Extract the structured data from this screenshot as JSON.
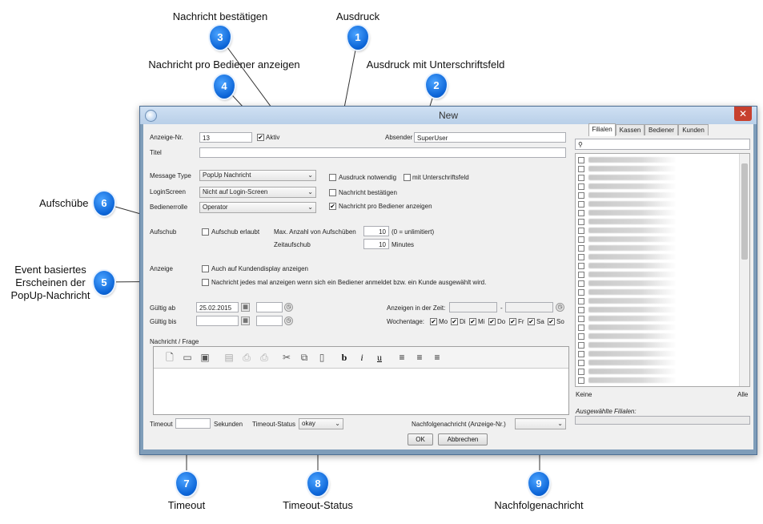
{
  "callouts": [
    {
      "n": "1",
      "label": "Ausdruck"
    },
    {
      "n": "2",
      "label": "Ausdruck mit Unterschriftsfeld"
    },
    {
      "n": "3",
      "label": "Nachricht bestätigen"
    },
    {
      "n": "4",
      "label": "Nachricht pro Bediener anzeigen"
    },
    {
      "n": "5",
      "label": "Event basiertes\nErscheinen der\nPopUp-Nachricht"
    },
    {
      "n": "6",
      "label": "Aufschübe"
    },
    {
      "n": "7",
      "label": "Timeout"
    },
    {
      "n": "8",
      "label": "Timeout-Status"
    },
    {
      "n": "9",
      "label": "Nachfolgenachricht"
    }
  ],
  "window": {
    "title": "New",
    "close_glyph": "✕"
  },
  "form": {
    "anzeige_nr_label": "Anzeige-Nr.",
    "anzeige_nr_value": "13",
    "aktiv_label": "Aktiv",
    "aktiv_checked": "✔",
    "absender_label": "Absender",
    "absender_value": "SuperUser",
    "titel_label": "Titel",
    "titel_value": "",
    "message_type_label": "Message Type",
    "message_type_value": "PopUp Nachricht",
    "loginscreen_label": "LoginScreen",
    "loginscreen_value": "Nicht auf Login-Screen",
    "bedienerrolle_label": "Bedienerrolle",
    "bedienerrolle_value": "Operator",
    "ausdruck_notwendig_label": "Ausdruck notwendig",
    "mit_unterschriftsfeld_label": "mit Unterschriftsfeld",
    "nachricht_bestaetigen_label": "Nachricht bestätigen",
    "nachricht_pro_bediener_label": "Nachricht pro Bediener anzeigen",
    "nachricht_pro_bediener_checked": "✔",
    "aufschub_label": "Aufschub",
    "aufschub_erlaubt_label": "Aufschub erlaubt",
    "max_aufschuebe_label": "Max. Anzahl von Aufschüben",
    "max_aufschuebe_value": "10",
    "unlimitiert_note": "(0 = unlimitiert)",
    "zeitaufschub_label": "Zeitaufschub",
    "zeitaufschub_value": "10",
    "minutes_label": "Minutes",
    "anzeige_label": "Anzeige",
    "kundendisplay_label": "Auch auf Kundendisplay anzeigen",
    "jedes_mal_label": "Nachricht jedes mal anzeigen wenn sich ein Bediener anmeldet bzw. ein Kunde ausgewählt wird.",
    "gueltig_ab_label": "Gültig ab",
    "gueltig_ab_value": "25.02.2015",
    "gueltig_bis_label": "Gültig bis",
    "gueltig_bis_value": "",
    "anzeigen_zeit_label": "Anzeigen in der Zeit:",
    "zeit_separator": "-",
    "wochentage_label": "Wochentage:",
    "days": [
      "Mo",
      "Di",
      "Mi",
      "Do",
      "Fr",
      "Sa",
      "So"
    ],
    "nachricht_frage_label": "Nachricht / Frage",
    "timeout_label": "Timeout",
    "timeout_value": "",
    "sekunden_label": "Sekunden",
    "timeout_status_label": "Timeout-Status",
    "timeout_status_value": "okay",
    "nachfolge_label": "Nachfolgenachricht (Anzeige-Nr.)",
    "nachfolge_value": "",
    "ok_label": "OK",
    "abbrechen_label": "Abbrechen"
  },
  "toolbar_icons": [
    "new-doc-icon",
    "open-folder-icon",
    "save-icon",
    "preview-icon",
    "print-icon",
    "print-setup-icon",
    "cut-icon",
    "copy-icon",
    "paste-icon",
    "bold-icon",
    "italic-icon",
    "underline-icon",
    "align-left-icon",
    "align-center-icon",
    "align-right-icon"
  ],
  "toolbar_glyphs": {
    "bold": "b",
    "italic": "i",
    "underline": "u"
  },
  "right_panel": {
    "tabs": [
      "Filialen",
      "Kassen",
      "Bediener",
      "Kunden"
    ],
    "search_glyph": "⚲",
    "keine_label": "Keine",
    "alle_label": "Alle",
    "ausgewaehlte_label": "Ausgewählte Filialen:"
  }
}
